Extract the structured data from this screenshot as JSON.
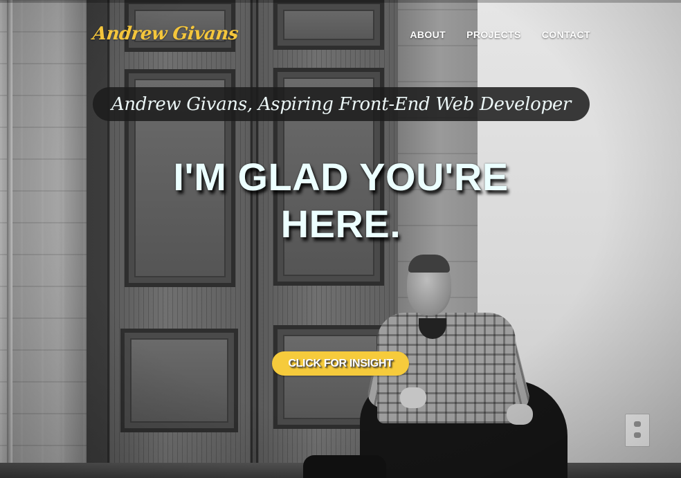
{
  "nav": {
    "brand": "Andrew Givans",
    "links": [
      "ABOUT",
      "PROJECTS",
      "CONTACT"
    ]
  },
  "hero": {
    "tagline": "Andrew Givans, Aspiring Front-End Web Developer",
    "headline_line1": "I'M GLAD YOU'RE",
    "headline_line2": "HERE.",
    "cta_label": "CLICK FOR INSIGHT"
  },
  "colors": {
    "brand": "#f4c63c",
    "cta_background": "#f6cb3c",
    "tagline_background": "#1c1c1c",
    "headline_text": "#ecffff"
  }
}
